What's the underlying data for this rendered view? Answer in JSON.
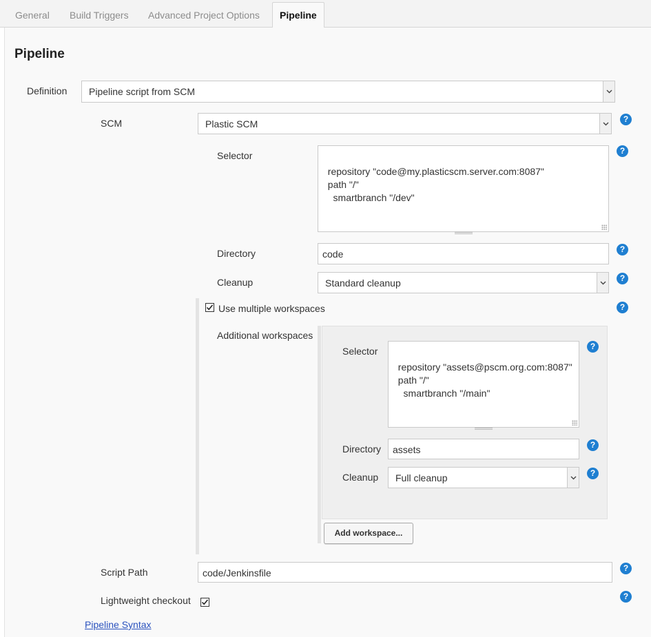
{
  "tabs": [
    {
      "label": "General"
    },
    {
      "label": "Build Triggers"
    },
    {
      "label": "Advanced Project Options"
    },
    {
      "label": "Pipeline",
      "active": true
    }
  ],
  "section_title": "Pipeline",
  "definition": {
    "label": "Definition",
    "value": "Pipeline script from SCM"
  },
  "scm": {
    "label": "SCM",
    "value": "Plastic SCM"
  },
  "selector": {
    "label": "Selector",
    "value": "repository \"code@my.plasticscm.server.com:8087\"\n  path \"/\"\n    smartbranch \"/dev\""
  },
  "directory": {
    "label": "Directory",
    "value": "code"
  },
  "cleanup": {
    "label": "Cleanup",
    "value": "Standard cleanup"
  },
  "multiple_workspaces": {
    "label": "Use multiple workspaces",
    "checked": true
  },
  "additional_workspaces": {
    "label": "Additional workspaces",
    "selector": {
      "label": "Selector",
      "value": "repository \"assets@pscm.org.com:8087\"\n  path \"/\"\n    smartbranch \"/main\""
    },
    "directory": {
      "label": "Directory",
      "value": "assets"
    },
    "cleanup": {
      "label": "Cleanup",
      "value": "Full cleanup"
    },
    "add_button": "Add workspace..."
  },
  "script_path": {
    "label": "Script Path",
    "value": "code/Jenkinsfile"
  },
  "lightweight_checkout": {
    "label": "Lightweight checkout",
    "checked": true
  },
  "pipeline_syntax_link": "Pipeline Syntax",
  "help_icon_text": "?",
  "colors": {
    "help": "#1f7fd1",
    "link": "#2a52be",
    "tab_active_text": "#111111",
    "tab_text": "#8c8c8c"
  }
}
